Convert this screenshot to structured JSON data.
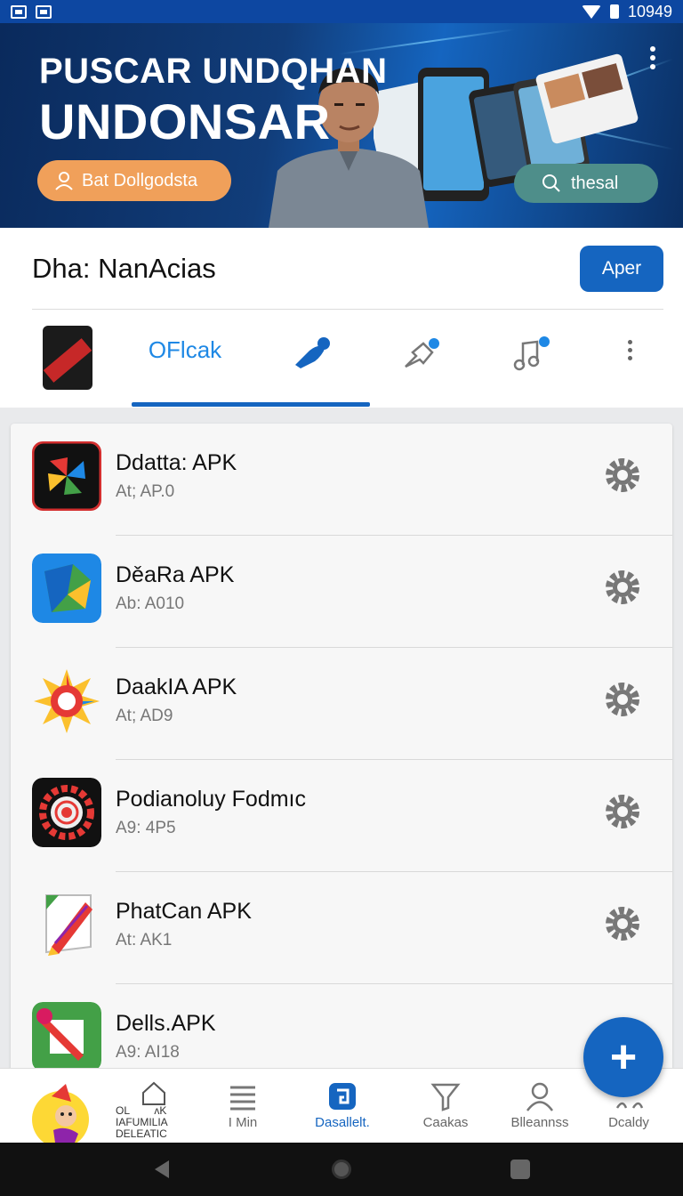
{
  "status_bar": {
    "time": "10949"
  },
  "hero": {
    "title_line1": "PUSCAR UNDQHAN",
    "title_line2": "UNDONSAR",
    "left_button_label": "Bat Dollgodsta",
    "right_button_label": "thesal"
  },
  "header": {
    "title": "Dha: NanAcias",
    "action_button_label": "Aper"
  },
  "tabs": {
    "active_label": "OFlcak"
  },
  "apps": [
    {
      "name": "Ddatta: APK",
      "subtitle": "At; AP.0",
      "icon": "pinwheel-icon"
    },
    {
      "name": "DěaRa APK",
      "subtitle": "Ab: A010",
      "icon": "folded-map-icon"
    },
    {
      "name": "DaakIA APK",
      "subtitle": "At; AD9",
      "icon": "sun-ring-icon"
    },
    {
      "name": "Podianoluy Fodmıc",
      "subtitle": "A9: 4P5",
      "icon": "gear-target-icon"
    },
    {
      "name": "PhatCan APK",
      "subtitle": "At: AK1",
      "icon": "pencil-icon"
    },
    {
      "name": "Dells.APK",
      "subtitle": "A9: AI18",
      "icon": "green-brush-icon"
    }
  ],
  "bottom_nav": {
    "mini_text": [
      "OL",
      "ʌK",
      "IAFUMILIA",
      "DELEATIC"
    ],
    "items": [
      {
        "label": "I Min",
        "icon": "list-icon"
      },
      {
        "label": "Dasallelt.",
        "icon": "square-g-icon"
      },
      {
        "label": "Caakas",
        "icon": "funnel-icon"
      },
      {
        "label": "Blleannss",
        "icon": "person-icon"
      },
      {
        "label": "Dcaldy",
        "icon": "partial-icon"
      }
    ]
  },
  "colors": {
    "primary": "#1565c0",
    "accent_orange": "#f0a05a",
    "teal": "#4e8e8a"
  }
}
